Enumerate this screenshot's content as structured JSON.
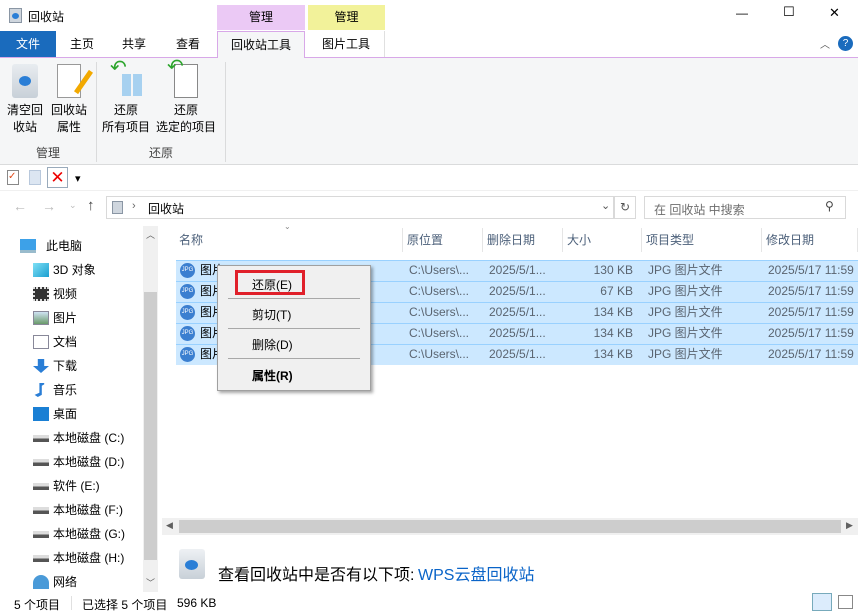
{
  "window": {
    "title": "回收站",
    "controls": {
      "minimize": "—",
      "maximize": "☐",
      "close": "✕"
    }
  },
  "contextual_headers": [
    {
      "label": "管理",
      "color": "#ebc9f5"
    },
    {
      "label": "管理",
      "color": "#f2f29a"
    }
  ],
  "tabs": [
    {
      "label": "文件"
    },
    {
      "label": "主页"
    },
    {
      "label": "共享"
    },
    {
      "label": "查看"
    },
    {
      "label": "回收站工具"
    },
    {
      "label": "图片工具"
    }
  ],
  "ribbon": {
    "buttons": [
      {
        "line1": "清空回",
        "line2": "收站"
      },
      {
        "line1": "回收站",
        "line2": "属性"
      },
      {
        "line1": "还原",
        "line2": "所有项目"
      },
      {
        "line1": "还原",
        "line2": "选定的项目"
      }
    ],
    "groups": [
      {
        "label": "管理"
      },
      {
        "label": "还原"
      }
    ]
  },
  "qat": {
    "dropdown": "▾"
  },
  "address": {
    "path": "回收站",
    "search_placeholder": "在 回收站 中搜索"
  },
  "nav": {
    "items": [
      {
        "label": "此电脑",
        "icon": "computer-icon"
      },
      {
        "label": "3D 对象",
        "icon": "cube-icon"
      },
      {
        "label": "视频",
        "icon": "video-icon"
      },
      {
        "label": "图片",
        "icon": "picture-icon"
      },
      {
        "label": "文档",
        "icon": "document-icon"
      },
      {
        "label": "下载",
        "icon": "download-icon"
      },
      {
        "label": "音乐",
        "icon": "music-icon"
      },
      {
        "label": "桌面",
        "icon": "desktop-icon"
      },
      {
        "label": "本地磁盘 (C:)",
        "icon": "drive-icon"
      },
      {
        "label": "本地磁盘 (D:)",
        "icon": "drive-icon"
      },
      {
        "label": "软件 (E:)",
        "icon": "drive-icon"
      },
      {
        "label": "本地磁盘 (F:)",
        "icon": "drive-icon"
      },
      {
        "label": "本地磁盘 (G:)",
        "icon": "drive-icon"
      },
      {
        "label": "本地磁盘 (H:)",
        "icon": "drive-icon"
      },
      {
        "label": "网络",
        "icon": "network-icon"
      }
    ]
  },
  "columns": [
    "名称",
    "原位置",
    "删除日期",
    "大小",
    "项目类型",
    "修改日期"
  ],
  "rows": [
    {
      "name": "图片1",
      "loc": "C:\\Users\\...",
      "del": "2025/5/1...",
      "size": "130 KB",
      "type": "JPG 图片文件",
      "mod": "2025/5/17 11:59"
    },
    {
      "name": "图片",
      "loc": "C:\\Users\\...",
      "del": "2025/5/1...",
      "size": "67 KB",
      "type": "JPG 图片文件",
      "mod": "2025/5/17 11:59"
    },
    {
      "name": "图片",
      "loc": "C:\\Users\\...",
      "del": "2025/5/1...",
      "size": "134 KB",
      "type": "JPG 图片文件",
      "mod": "2025/5/17 11:59"
    },
    {
      "name": "图片",
      "loc": "C:\\Users\\...",
      "del": "2025/5/1...",
      "size": "134 KB",
      "type": "JPG 图片文件",
      "mod": "2025/5/17 11:59"
    },
    {
      "name": "图片",
      "loc": "C:\\Users\\...",
      "del": "2025/5/1...",
      "size": "134 KB",
      "type": "JPG 图片文件",
      "mod": "2025/5/17 11:59"
    }
  ],
  "context_menu": {
    "items": [
      "还原(E)",
      "剪切(T)",
      "删除(D)",
      "属性(R)"
    ]
  },
  "wps": {
    "text": "查看回收站中是否有以下项:",
    "link": "WPS云盘回收站"
  },
  "status": {
    "count": "5 个项目",
    "selected": "已选择 5 个项目",
    "size": "596 KB"
  }
}
